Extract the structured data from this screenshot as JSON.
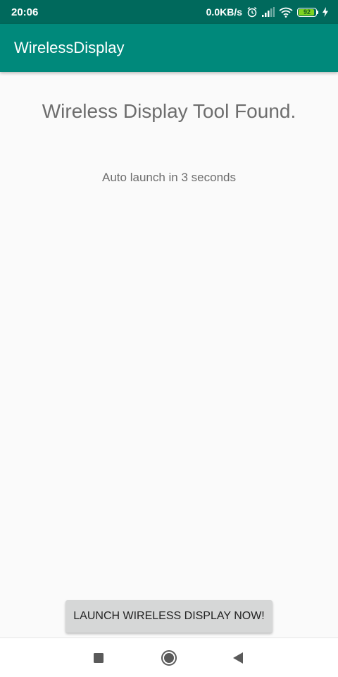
{
  "status_bar": {
    "time": "20:06",
    "network_speed": "0.0KB/s",
    "battery_level": "92",
    "battery_percent": 92,
    "icons": [
      "alarm-icon",
      "signal-icon",
      "wifi-icon",
      "battery-icon",
      "charging-icon"
    ],
    "battery_color": "#7ed321"
  },
  "app_bar": {
    "title": "WirelessDisplay",
    "color": "#00897b"
  },
  "main": {
    "headline": "Wireless Display Tool Found.",
    "subtext": "Auto launch in 3 seconds",
    "launch_button_label": "LAUNCH WIRELESS DISPLAY NOW!"
  },
  "nav_bar": {
    "icons": [
      "recent-apps-icon",
      "home-icon",
      "back-icon"
    ]
  }
}
